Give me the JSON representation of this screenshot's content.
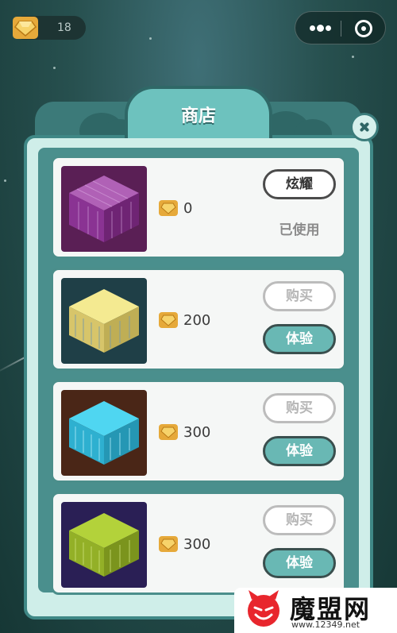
{
  "top_bar": {
    "gem_count": "18",
    "gem_icon": "gold-gem-icon",
    "more_icon": "more-dots-icon",
    "close_app_icon": "target-circle-icon"
  },
  "shop": {
    "title": "商店",
    "close_icon": "close-x-icon",
    "items": [
      {
        "color": "#9c3a9f",
        "bg": "#5a1f55",
        "price": "0",
        "action_label": "炫耀",
        "status": "已使用"
      },
      {
        "color": "#f1e68a",
        "bg": "#1f3f47",
        "price": "200",
        "buy_label": "购买",
        "try_label": "体验"
      },
      {
        "color": "#4fd3ee",
        "bg": "#4a2617",
        "price": "300",
        "buy_label": "购买",
        "try_label": "体验"
      },
      {
        "color": "#a8c82c",
        "bg": "#2a1f55",
        "price": "300",
        "buy_label": "购买",
        "try_label": "体验"
      }
    ]
  },
  "watermark": {
    "name": "魔盟网",
    "url": "www.12349.net"
  }
}
